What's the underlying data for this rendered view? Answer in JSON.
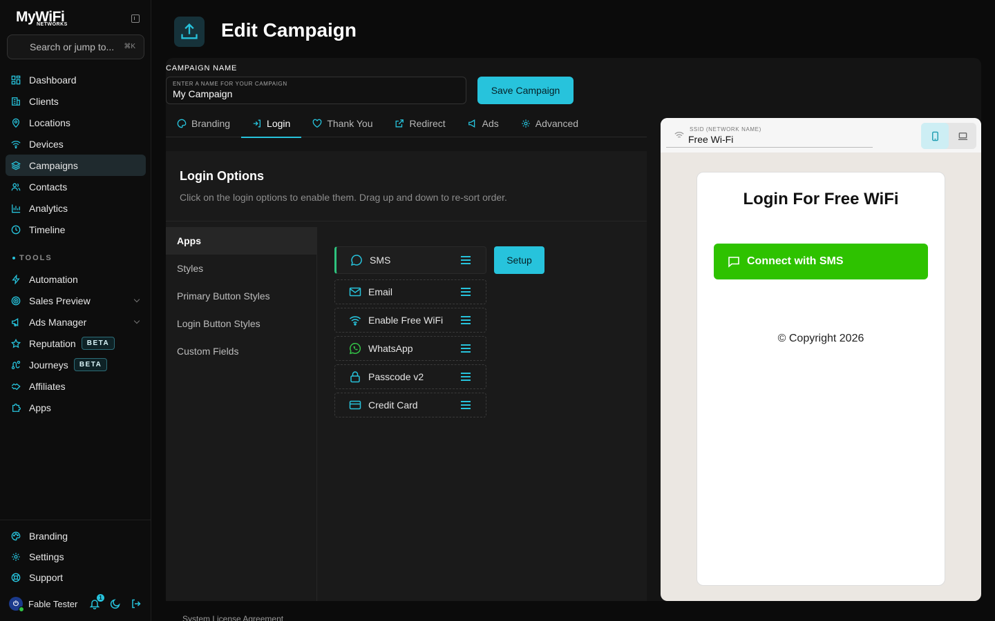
{
  "app": {
    "brand": "MyWiFi",
    "brand_sub": "NETWORKS"
  },
  "search": {
    "placeholder": "Search or jump to...",
    "shortcut": "⌘K"
  },
  "sidebar": {
    "items": [
      {
        "label": "Dashboard",
        "icon": "grid-icon"
      },
      {
        "label": "Clients",
        "icon": "building-icon"
      },
      {
        "label": "Locations",
        "icon": "map-pin-icon"
      },
      {
        "label": "Devices",
        "icon": "wifi-icon"
      },
      {
        "label": "Campaigns",
        "icon": "layers-icon",
        "active": true
      },
      {
        "label": "Contacts",
        "icon": "users-icon"
      },
      {
        "label": "Analytics",
        "icon": "bar-chart-icon"
      },
      {
        "label": "Timeline",
        "icon": "clock-icon"
      }
    ],
    "tools_heading": "TOOLS",
    "tools": [
      {
        "label": "Automation",
        "icon": "zap-icon"
      },
      {
        "label": "Sales Preview",
        "icon": "target-icon",
        "chevron": true
      },
      {
        "label": "Ads Manager",
        "icon": "megaphone-icon",
        "chevron": true
      },
      {
        "label": "Reputation",
        "icon": "star-icon",
        "badge": "BETA"
      },
      {
        "label": "Journeys",
        "icon": "route-icon",
        "badge": "BETA"
      },
      {
        "label": "Affiliates",
        "icon": "handshake-icon"
      },
      {
        "label": "Apps",
        "icon": "puzzle-icon"
      }
    ],
    "bottom": [
      {
        "label": "Branding",
        "icon": "palette-icon"
      },
      {
        "label": "Settings",
        "icon": "gear-icon"
      },
      {
        "label": "Support",
        "icon": "lifebuoy-icon"
      }
    ],
    "user": {
      "name": "Fable Tester",
      "notifications": "1"
    }
  },
  "header": {
    "title": "Edit Campaign"
  },
  "campaign": {
    "label": "CAMPAIGN NAME",
    "input_hint": "ENTER A NAME FOR YOUR CAMPAIGN",
    "value": "My Campaign",
    "save_label": "Save Campaign"
  },
  "tabs": [
    {
      "label": "Branding",
      "icon": "palette-icon"
    },
    {
      "label": "Login",
      "icon": "login-icon",
      "active": true
    },
    {
      "label": "Thank You",
      "icon": "heart-icon"
    },
    {
      "label": "Redirect",
      "icon": "external-link-icon"
    },
    {
      "label": "Ads",
      "icon": "megaphone-icon"
    },
    {
      "label": "Advanced",
      "icon": "gear-icon"
    }
  ],
  "login_options": {
    "title": "Login Options",
    "subtitle": "Click on the login options to enable them. Drag up and down to re-sort order.",
    "subnav": [
      "Apps",
      "Styles",
      "Primary Button Styles",
      "Login Button Styles",
      "Custom Fields"
    ],
    "items": [
      {
        "label": "SMS",
        "icon": "chat-icon",
        "selected": true
      },
      {
        "label": "Email",
        "icon": "mail-icon"
      },
      {
        "label": "Enable Free WiFi",
        "icon": "wifi-icon"
      },
      {
        "label": "WhatsApp",
        "icon": "whatsapp-icon"
      },
      {
        "label": "Passcode v2",
        "icon": "lock-icon"
      },
      {
        "label": "Credit Card",
        "icon": "credit-card-icon"
      }
    ],
    "setup_label": "Setup"
  },
  "preview": {
    "ssid_label": "SSID (NETWORK NAME)",
    "ssid_value": "Free Wi-Fi",
    "title": "Login For Free WiFi",
    "button_label": "Connect with SMS",
    "button_color": "#2ec200",
    "copyright": "© Copyright 2026"
  },
  "footer": {
    "link": "System License Agreement"
  },
  "colors": {
    "accent": "#27c3dc",
    "background": "#0b0b0b"
  }
}
